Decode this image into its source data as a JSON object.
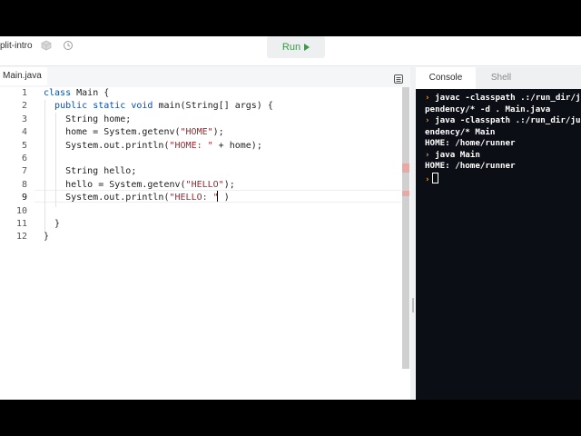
{
  "header": {
    "project_name": "plit-intro",
    "run_label": "Run",
    "icons": [
      "package-icon",
      "history-icon"
    ]
  },
  "editor": {
    "file_tab": "Main.java",
    "line_numbers": [
      "1",
      "2",
      "3",
      "4",
      "5",
      "6",
      "7",
      "8",
      "9",
      "10",
      "11",
      "12"
    ],
    "lines": [
      {
        "kw": "class",
        "text": " Main {"
      },
      {
        "indent": "  ",
        "kw": "public static void",
        "text": " main(String[] args) {"
      },
      {
        "text": "    String home;"
      },
      {
        "text": "    home = System.getenv(",
        "str": "\"HOME\"",
        "tail": ");"
      },
      {
        "text": "    System.out.println(",
        "str": "\"HOME: \"",
        "tail": " + home);"
      },
      {
        "text": ""
      },
      {
        "text": "    String hello;"
      },
      {
        "text": "    hello = System.getenv(",
        "str": "\"HELLO\"",
        "tail": ");"
      },
      {
        "text": "    System.out.println(",
        "str": "\"HELLO: \"",
        "tail": " )"
      },
      {
        "text": ""
      },
      {
        "text": "  }"
      },
      {
        "text": "}"
      }
    ]
  },
  "console": {
    "tabs": [
      "Console",
      "Shell"
    ],
    "active_tab": "Console",
    "prompt_symbol": "›",
    "lines": [
      {
        "prompt": true,
        "text": "javac -classpath .:/run_dir/ju"
      },
      {
        "prompt": false,
        "text": "pendency/* -d . Main.java"
      },
      {
        "prompt": true,
        "text": "java -classpath .:/run_dir/ju"
      },
      {
        "prompt": false,
        "text": "endency/* Main"
      },
      {
        "prompt": false,
        "text": "HOME: /home/runner"
      },
      {
        "prompt": true,
        "text": "java Main"
      },
      {
        "prompt": false,
        "text": "HOME: /home/runner"
      },
      {
        "prompt": true,
        "text": ""
      }
    ]
  },
  "colors": {
    "keyword": "#0b4fa6",
    "string": "#a3252e",
    "run_green": "#2f9e44",
    "prompt_orange": "#f2a93b",
    "console_bg": "#0b0e14"
  }
}
